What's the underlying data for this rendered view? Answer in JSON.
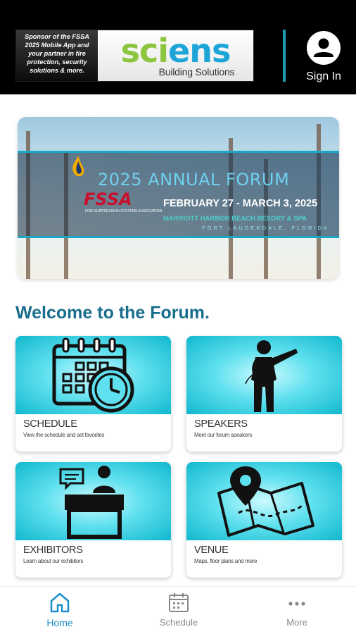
{
  "header": {
    "sponsor_text": "Sponsor of the FSSA 2025 Mobile App and your partner in fire protection, security solutions & more.",
    "brand_name_part1": "sci",
    "brand_name_part2": "ens",
    "brand_sub": "Building Solutions",
    "sign_in_label": "Sign In",
    "divider_color": "#1ea0b4"
  },
  "banner": {
    "org": "FSSA",
    "org_tagline": "FIRE SUPPRESSION SYSTEMS ASSOCIATION",
    "title": "2025 ANNUAL FORUM",
    "dates": "FEBRUARY 27 - MARCH 3, 2025",
    "venue": "MARRIOTT HARBOR BEACH RESORT & SPA",
    "city": "FORT LAUDERDALE, FLORIDA"
  },
  "welcome": "Welcome to the Forum.",
  "cards": [
    {
      "title": "SCHEDULE",
      "subtitle": "View the schedule and set favorites",
      "icon": "calendar-clock-icon"
    },
    {
      "title": "SPEAKERS",
      "subtitle": "Meet our forum speakers",
      "icon": "presenter-icon"
    },
    {
      "title": "EXHIBITORS",
      "subtitle": "Learn about our exhibitors",
      "icon": "exhibitor-booth-icon"
    },
    {
      "title": "VENUE",
      "subtitle": "Maps, floor plans and more",
      "icon": "map-pin-icon"
    }
  ],
  "nav": [
    {
      "label": "Home",
      "icon": "home-icon",
      "active": true
    },
    {
      "label": "Schedule",
      "icon": "calendar-icon",
      "active": false
    },
    {
      "label": "More",
      "icon": "more-dots-icon",
      "active": false
    }
  ],
  "colors": {
    "accent": "#1b8fc8",
    "welcome": "#186e8c",
    "card_bg": "#11b8cf"
  }
}
